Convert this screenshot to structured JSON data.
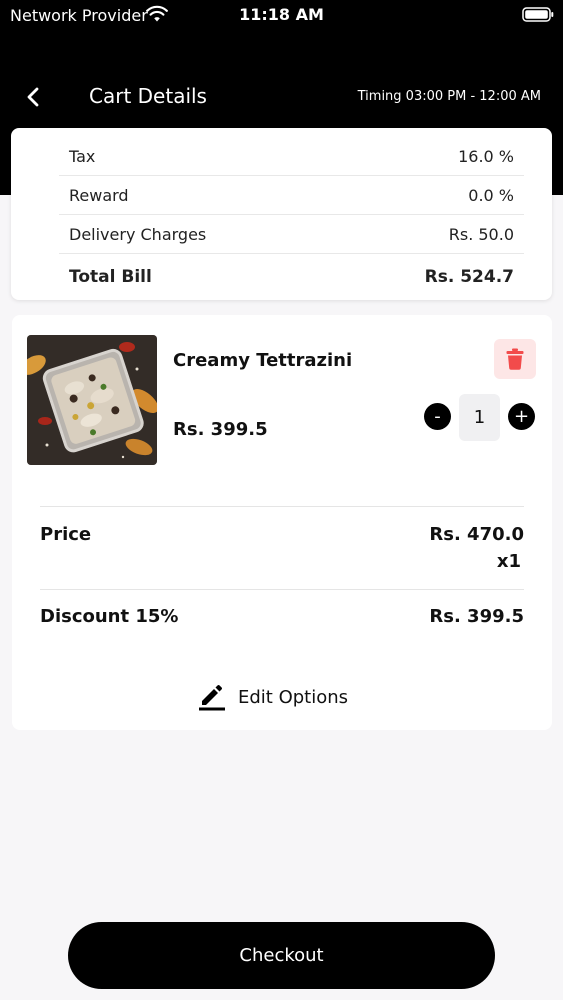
{
  "status_bar": {
    "carrier": "Network Provider",
    "time": "11:18 AM"
  },
  "header": {
    "title": "Cart Details",
    "timing": "Timing 03:00 PM - 12:00 AM"
  },
  "summary": {
    "rows": [
      {
        "label": "Tax",
        "value": "16.0 %"
      },
      {
        "label": "Reward",
        "value": "0.0 %"
      },
      {
        "label": "Delivery Charges",
        "value": "Rs. 50.0"
      }
    ],
    "total": {
      "label": "Total Bill",
      "value": "Rs. 524.7"
    }
  },
  "item": {
    "name": "Creamy Tettrazini",
    "price": "Rs. 399.5",
    "quantity": "1",
    "qty_minus": "-",
    "qty_plus": "+"
  },
  "breakdown": {
    "price_label": "Price",
    "price_value": "Rs. 470.0",
    "price_qty": "x1",
    "discount_label": "Discount 15%",
    "discount_value": "Rs. 399.5",
    "edit_label": "Edit Options"
  },
  "checkout": {
    "label": "Checkout"
  },
  "colors": {
    "header_bg": "#000000",
    "delete_bg": "#fde6e6",
    "delete_icon": "#f24b4b",
    "page_bg": "#f7f6f8"
  },
  "icons": {
    "back": "chevron-left-icon",
    "delete": "trash-icon",
    "edit": "pencil-icon",
    "wifi": "wifi-icon",
    "battery": "battery-icon"
  }
}
